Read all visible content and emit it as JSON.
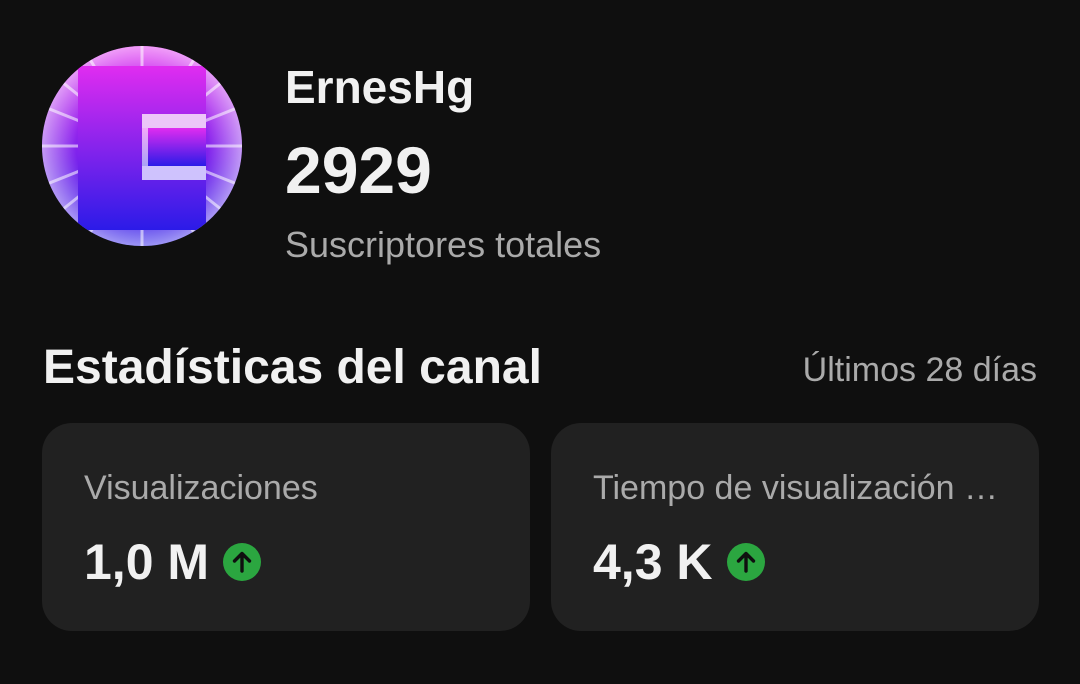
{
  "channel": {
    "name": "ErnesHg",
    "subscriber_count": "2929",
    "subscriber_label": "Suscriptores totales",
    "avatar_icon": "channel-avatar-letter-e"
  },
  "stats": {
    "title": "Estadísticas del canal",
    "period": "Últimos 28 días",
    "cards": [
      {
        "label": "Visualizaciones",
        "value": "1,0 M",
        "trend": "up",
        "trend_icon": "arrow-up-icon"
      },
      {
        "label": "Tiempo de visualización (horas)",
        "value": "4,3 K",
        "trend": "up",
        "trend_icon": "arrow-up-icon"
      }
    ]
  },
  "colors": {
    "background": "#0f0f0f",
    "card": "#212121",
    "text_primary": "#f1f1f1",
    "text_secondary": "#aaaaaa",
    "trend_up": "#2ba640",
    "avatar_top": "#e02cf0",
    "avatar_bottom": "#2b1be8"
  }
}
